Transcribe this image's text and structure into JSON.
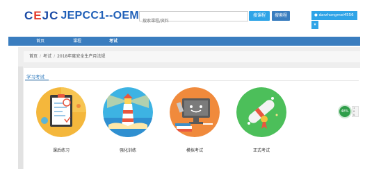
{
  "header": {
    "logo_mark": [
      "C",
      "E",
      "J",
      "C"
    ],
    "logo_text": "JEPCC1--OEM",
    "search_placeholder": "搜索课程/资料",
    "search_button_a": "搜课程",
    "search_button_b": "搜索程",
    "user_name": "darzhongmei4556",
    "user_caret": "▾"
  },
  "nav": {
    "items": [
      "首页",
      "课程",
      "考试"
    ]
  },
  "breadcrumb": {
    "items": [
      "首页",
      "考试",
      "2018年度安全生产月法规"
    ],
    "separator": "/"
  },
  "section": {
    "title": "学习考试"
  },
  "cards": [
    {
      "label": "课后练习",
      "icon": "exam-paper-icon"
    },
    {
      "label": "强化训练",
      "icon": "lighthouse-icon"
    },
    {
      "label": "模拟考试",
      "icon": "computer-monitor-icon"
    },
    {
      "label": "正式考试",
      "icon": "diploma-icon"
    }
  ],
  "widget": {
    "percent": "48%",
    "lines": [
      "1",
      "0.",
      "0."
    ]
  },
  "colors": {
    "brand_blue": "#2060b8",
    "nav_blue": "#3a7dbf",
    "accent": "#2fa4e7",
    "logo_red": "#e23b2e"
  }
}
